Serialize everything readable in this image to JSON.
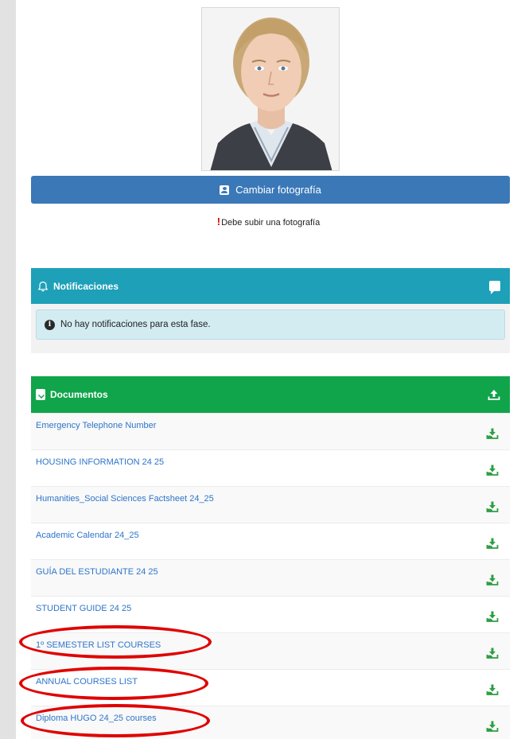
{
  "profile": {
    "change_photo_label": "Cambiar fotografía",
    "warning_mark": "!",
    "warning_text": "Debe subir una fotografía"
  },
  "notifications": {
    "title": "Notificaciones",
    "info_letter": "i",
    "message": "No hay notificaciones para esta fase."
  },
  "documents": {
    "title": "Documentos",
    "items": [
      {
        "label": "Emergency Telephone Number"
      },
      {
        "label": "HOUSING INFORMATION 24 25"
      },
      {
        "label": "Humanities_Social Sciences Factsheet 24_25"
      },
      {
        "label": "Academic Calendar 24_25"
      },
      {
        "label": "GUÍA DEL ESTUDIANTE 24 25"
      },
      {
        "label": "STUDENT GUIDE 24 25"
      },
      {
        "label": "1º SEMESTER LIST COURSES"
      },
      {
        "label": "ANNUAL COURSES LIST"
      },
      {
        "label": "Diploma HUGO 24_25 courses"
      }
    ]
  },
  "colors": {
    "button_blue": "#3a78b8",
    "notif_teal": "#1ea0b8",
    "docs_green": "#10a44b",
    "link_blue": "#2e75c9",
    "highlight_red": "#e00000"
  },
  "icons": {
    "change_photo": "user-card-icon",
    "notifications": "bell-icon",
    "notifications_action": "chat-icon",
    "documents": "file-download-icon",
    "documents_action": "upload-icon",
    "row_action": "download-icon"
  }
}
